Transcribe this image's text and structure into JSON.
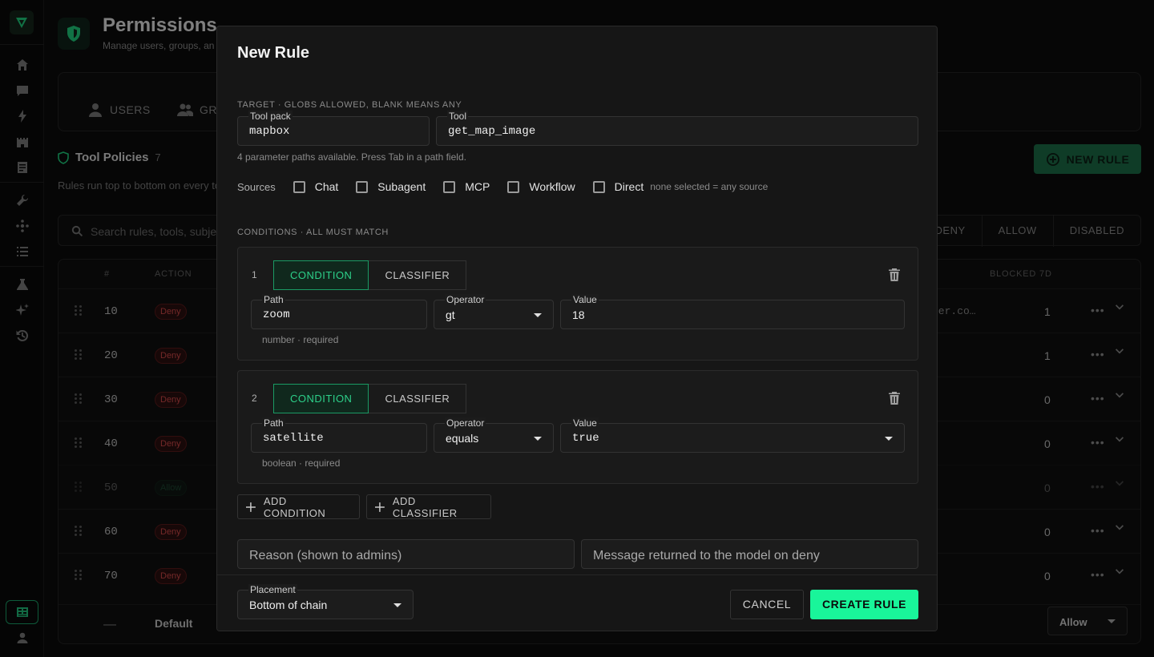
{
  "page": {
    "title": "Permissions",
    "subtitle": "Manage users, groups, an",
    "tabs": [
      {
        "label": "USERS",
        "icon": "person-icon"
      },
      {
        "label": "GR",
        "icon": "group-icon"
      }
    ],
    "tool_policies": {
      "title": "Tool Policies",
      "count": "7",
      "description": "Rules run top to bottom on every to"
    },
    "new_rule_label": "NEW RULE",
    "search_placeholder": "Search rules, tools, subje",
    "filters": [
      "DENY",
      "ALLOW",
      "DISABLED"
    ],
    "table": {
      "headers": {
        "num": "#",
        "action": "ACTION",
        "blocked": "BLOCKED 7D"
      },
      "rows": [
        {
          "num": "10",
          "action": "Deny",
          "subject": "her.co…",
          "blocked": "1"
        },
        {
          "num": "20",
          "action": "Deny",
          "subject": "",
          "blocked": "1"
        },
        {
          "num": "30",
          "action": "Deny",
          "subject": "",
          "blocked": "0"
        },
        {
          "num": "40",
          "action": "Deny",
          "subject": "",
          "blocked": "0"
        },
        {
          "num": "50",
          "action": "Allow",
          "subject": "",
          "blocked": "0"
        },
        {
          "num": "60",
          "action": "Deny",
          "subject": "",
          "blocked": "0"
        },
        {
          "num": "70",
          "action": "Deny",
          "subject": "",
          "blocked": "0"
        }
      ],
      "more_glyph": "•••",
      "default_row": {
        "num": "—",
        "label": "Default",
        "value": "Allow"
      }
    }
  },
  "modal": {
    "title": "New Rule",
    "target_label": "TARGET · GLOBS ALLOWED, BLANK MEANS ANY",
    "tool_pack": {
      "label": "Tool pack",
      "value": "mapbox"
    },
    "tool": {
      "label": "Tool",
      "value": "get_map_image"
    },
    "hint": "4 parameter paths available. Press Tab in a path field.",
    "sources": {
      "label": "Sources",
      "options": [
        "Chat",
        "Subagent",
        "MCP",
        "Workflow",
        "Direct"
      ],
      "note": "none selected = any source"
    },
    "conditions_label": "CONDITIONS · ALL MUST MATCH",
    "conditions": [
      {
        "index": "1",
        "modes": [
          "CONDITION",
          "CLASSIFIER"
        ],
        "path": {
          "label": "Path",
          "value": "zoom"
        },
        "operator": {
          "label": "Operator",
          "value": "gt"
        },
        "value": {
          "label": "Value",
          "value": "18"
        },
        "hint": "number · required"
      },
      {
        "index": "2",
        "modes": [
          "CONDITION",
          "CLASSIFIER"
        ],
        "path": {
          "label": "Path",
          "value": "satellite"
        },
        "operator": {
          "label": "Operator",
          "value": "equals"
        },
        "value": {
          "label": "Value",
          "value": "true"
        },
        "hint": "boolean · required"
      }
    ],
    "add_condition": "ADD CONDITION",
    "add_classifier": "ADD CLASSIFIER",
    "reason_placeholder": "Reason (shown to admins)",
    "message_placeholder": "Message returned to the model on deny",
    "placement": {
      "label": "Placement",
      "value": "Bottom of chain"
    },
    "cancel": "CANCEL",
    "create": "CREATE RULE"
  },
  "colors": {
    "accent": "#19f59a",
    "accent_dim": "#1c6e48",
    "deny": "#d34a4a",
    "background": "#0b0b0b",
    "modal": "#161616"
  }
}
